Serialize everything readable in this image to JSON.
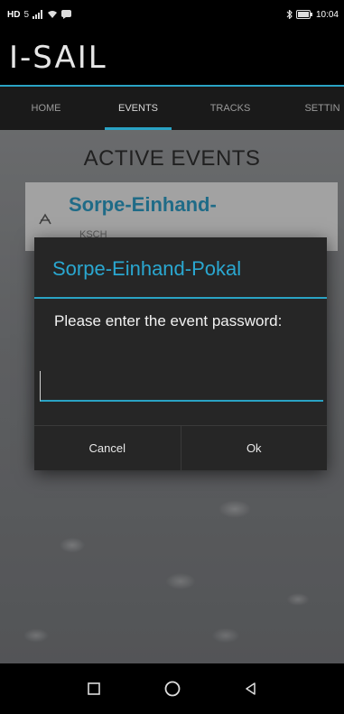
{
  "status_bar": {
    "left_text": "HD",
    "network_glyph": "5",
    "time": "10:04",
    "icons": [
      "signal-icon",
      "wifi-icon",
      "notification-icon",
      "bluetooth-icon",
      "battery-icon"
    ]
  },
  "header": {
    "logo_text": "I-SAIL",
    "accent_color": "#2aa3c4"
  },
  "tabs": [
    {
      "label": "HOME"
    },
    {
      "label": "EVENTS"
    },
    {
      "label": "TRACKS"
    },
    {
      "label": "SETTIN"
    }
  ],
  "main": {
    "title": "ACTIVE EVENTS",
    "event_card": {
      "title": "Sorpe-Einhand-",
      "subtitle": "KSCH",
      "icon": "sailboat-icon"
    }
  },
  "dialog": {
    "title": "Sorpe-Einhand-Pokal",
    "message": "Please enter the event password:",
    "input_value": "",
    "input_placeholder": "",
    "cancel_label": "Cancel",
    "ok_label": "Ok"
  },
  "nav_bar": {
    "icons": [
      "recent-apps-icon",
      "home-icon",
      "back-icon"
    ]
  }
}
